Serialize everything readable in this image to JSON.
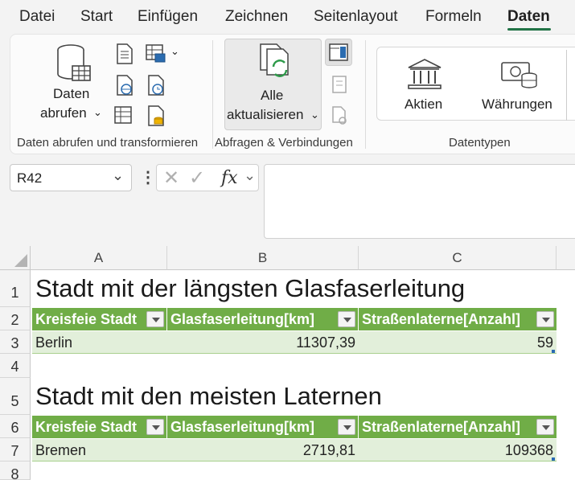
{
  "menu": {
    "tabs": [
      "Datei",
      "Start",
      "Einfügen",
      "Zeichnen",
      "Seitenlayout",
      "Formeln",
      "Daten"
    ],
    "active": "Daten"
  },
  "ribbon": {
    "get_data_line1": "Daten",
    "get_data_line2": "abrufen",
    "group_get": "Daten abrufen und transformieren",
    "refresh_line1": "Alle",
    "refresh_line2": "aktualisieren",
    "group_queries": "Abfragen & Verbindungen",
    "stocks": "Aktien",
    "currencies": "Währungen",
    "group_types": "Datentypen"
  },
  "formula_bar": {
    "name_box": "R42",
    "fx": "fx",
    "formula": ""
  },
  "sheet": {
    "columns": [
      "A",
      "B",
      "C"
    ],
    "rows": [
      "1",
      "2",
      "3",
      "4",
      "5",
      "6",
      "7",
      "8"
    ],
    "title1": "Stadt mit der längsten Glasfaserleitung",
    "title2": "Stadt mit den meisten Laternen",
    "headers": [
      "Kreisfeie Stadt",
      "Glasfaserleitung[km]",
      "Straßenlaterne[Anzahl]"
    ],
    "table1_row": [
      "Berlin",
      "11307,39",
      "59"
    ],
    "table2_row": [
      "Bremen",
      "2719,81",
      "109368"
    ]
  }
}
